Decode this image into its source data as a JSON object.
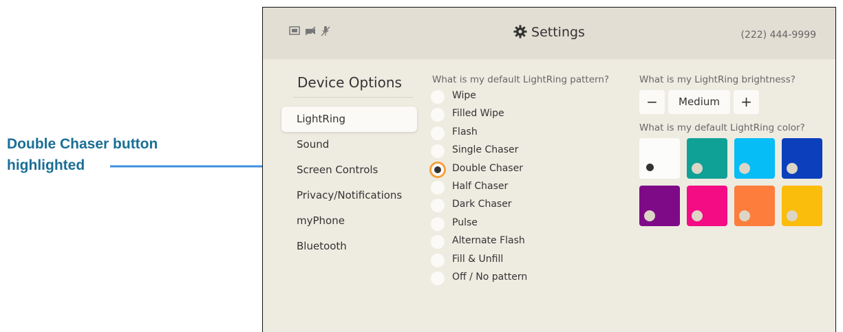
{
  "callout": {
    "line1": "Double Chaser button",
    "line2": "highlighted"
  },
  "header": {
    "title": "Settings",
    "phone": "(222) 444-9999",
    "status_icons": [
      "screen-icon",
      "video-off-icon",
      "mic-off-icon"
    ]
  },
  "sidebar": {
    "title": "Device Options",
    "items": [
      {
        "label": "LightRing",
        "active": true
      },
      {
        "label": "Sound"
      },
      {
        "label": "Screen Controls"
      },
      {
        "label": "Privacy/Notifications"
      },
      {
        "label": "myPhone"
      },
      {
        "label": "Bluetooth"
      }
    ]
  },
  "pattern": {
    "question": "What is my default LightRing pattern?",
    "selected": "Double Chaser",
    "options": [
      {
        "label": "Wipe"
      },
      {
        "label": "Filled Wipe"
      },
      {
        "label": "Flash"
      },
      {
        "label": "Single Chaser"
      },
      {
        "label": "Double Chaser"
      },
      {
        "label": "Half Chaser"
      },
      {
        "label": "Dark Chaser"
      },
      {
        "label": "Pulse"
      },
      {
        "label": "Alternate Flash"
      },
      {
        "label": "Fill & Unfill"
      },
      {
        "label": "Off / No pattern"
      }
    ]
  },
  "brightness": {
    "question": "What is my LightRing brightness?",
    "minus": "−",
    "value": "Medium",
    "plus": "+"
  },
  "color": {
    "question": "What is my default LightRing color?",
    "swatches": [
      "#fcfcfa",
      "#10a196",
      "#06bdf6",
      "#0b3fbb",
      "#7f0a87",
      "#f40c84",
      "#fc7d3c",
      "#fbbd0b"
    ],
    "selected_index": 0
  },
  "colors": {
    "accent_ring": "#f5a13c",
    "callout_text": "#1a6e96",
    "arrow": "#3d8fde"
  }
}
